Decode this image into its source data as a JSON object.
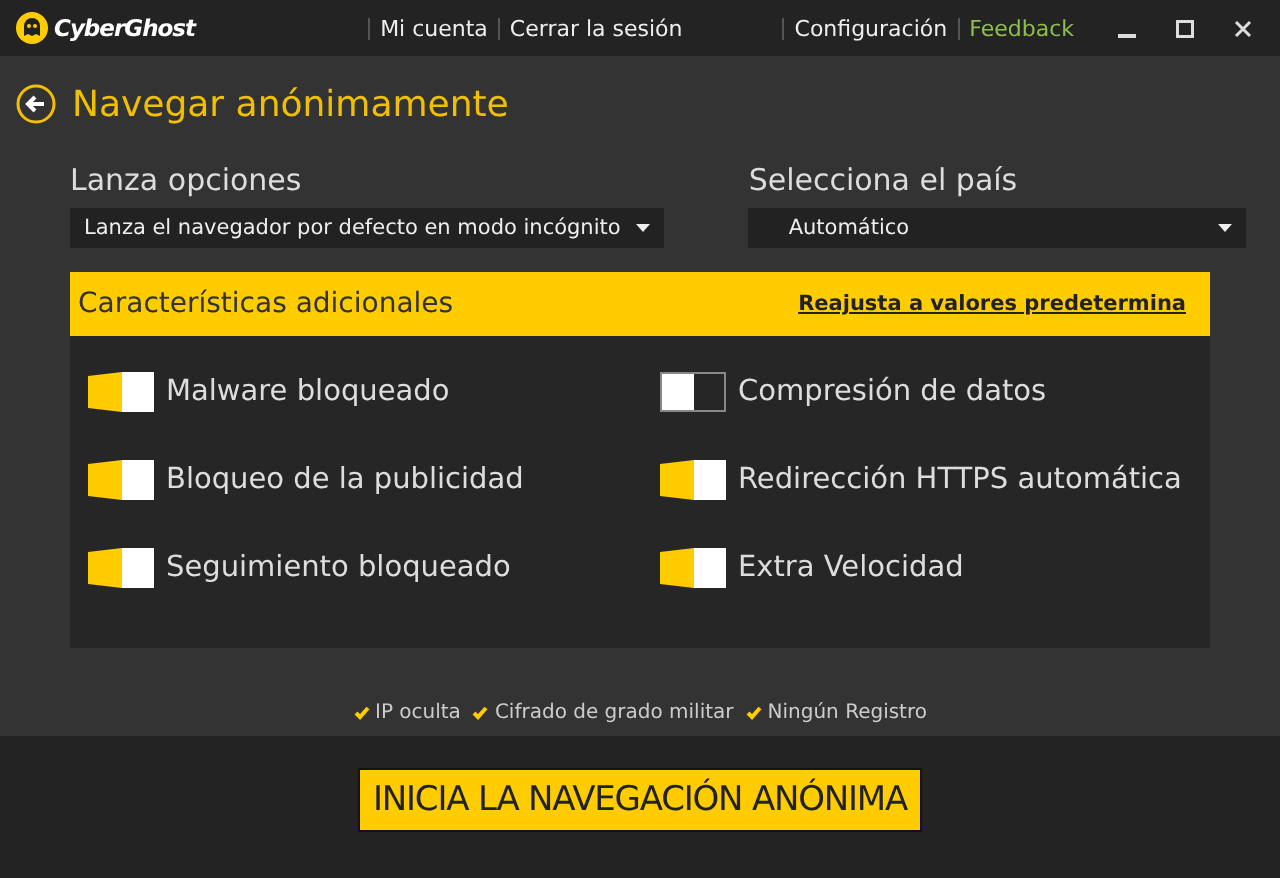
{
  "app": {
    "logo": "CyberGhost",
    "menu": [
      {
        "label": "Mi cuenta",
        "kind": "normal"
      },
      {
        "label": "Cerrar la sesión",
        "kind": "normal"
      },
      {
        "label": "Configuración",
        "kind": "normal"
      },
      {
        "label": "Feedback",
        "kind": "accent"
      }
    ]
  },
  "page": {
    "title": "Navegar anónimamente"
  },
  "launch": {
    "label": "Lanza opciones",
    "value": "Lanza el navegador por defecto en modo incógnito"
  },
  "country": {
    "label": "Selecciona el país",
    "value": "Automático"
  },
  "features": {
    "title": "Características adicionales",
    "reset_link": "Reajusta a valores predetermina",
    "toggles": [
      {
        "label": "Malware bloqueado",
        "on": true
      },
      {
        "label": "Compresión de datos",
        "on": false
      },
      {
        "label": "Bloqueo de la publicidad",
        "on": true
      },
      {
        "label": "Redirección HTTPS automática",
        "on": true
      },
      {
        "label": "Seguimiento bloqueado",
        "on": true
      },
      {
        "label": "Extra Velocidad",
        "on": true
      }
    ]
  },
  "badges": [
    "IP oculta",
    "Cifrado de grado militar",
    "Ningún Registro"
  ],
  "start_button": "INICIA LA NAVEGACIÓN ANÓNIMA"
}
